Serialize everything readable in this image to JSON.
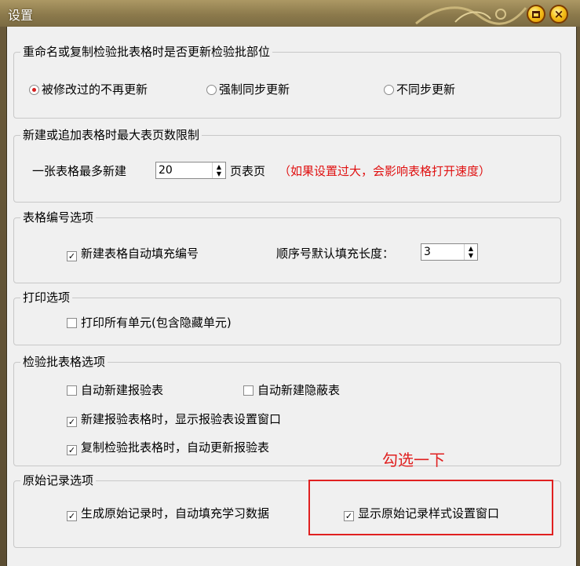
{
  "window": {
    "title": "设置"
  },
  "groups": {
    "rename": {
      "legend": "重命名或复制检验批表格时是否更新检验批部位",
      "options": [
        {
          "label": "被修改过的不再更新",
          "selected": true
        },
        {
          "label": "强制同步更新",
          "selected": false
        },
        {
          "label": "不同步更新",
          "selected": false
        }
      ]
    },
    "pages": {
      "legend": "新建或追加表格时最大表页数限制",
      "prefix": "一张表格最多新建",
      "value": "20",
      "suffix": "页表页",
      "warning": "（如果设置过大，会影响表格打开速度）"
    },
    "numbering": {
      "legend": "表格编号选项",
      "auto_fill": {
        "label": "新建表格自动填充编号",
        "checked": true
      },
      "seq_label": "顺序号默认填充长度：",
      "seq_value": "3"
    },
    "print": {
      "legend": "打印选项",
      "print_all": {
        "label": "打印所有单元(包含隐藏单元)",
        "checked": false
      }
    },
    "inspection": {
      "legend": "检验批表格选项",
      "auto_report": {
        "label": "自动新建报验表",
        "checked": false
      },
      "auto_hidden": {
        "label": "自动新建隐蔽表",
        "checked": false
      },
      "show_window": {
        "label": "新建报验表格时，显示报验表设置窗口",
        "checked": true
      },
      "copy_update": {
        "label": "复制检验批表格时，自动更新报验表",
        "checked": true
      }
    },
    "record": {
      "legend": "原始记录选项",
      "auto_fill": {
        "label": "生成原始记录时，自动填充学习数据",
        "checked": true
      },
      "show_style": {
        "label": "显示原始记录样式设置窗口",
        "checked": true
      }
    }
  },
  "annotation": {
    "text": "勾选一下",
    "color": "#e02020"
  },
  "icons": {
    "minimize": "minimize-icon",
    "close": "close-icon",
    "check": "✓"
  }
}
